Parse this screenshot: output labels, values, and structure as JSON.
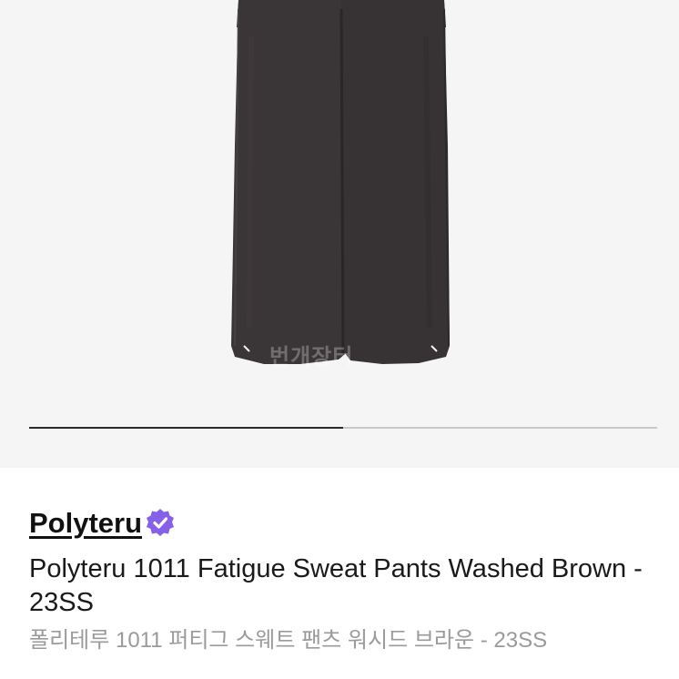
{
  "gallery": {
    "watermark_text": "번개장터",
    "progress": 0.5,
    "colors": {
      "background": "#f5f5f5",
      "pants": "#3a3536",
      "track": "#c8c8c8",
      "fill": "#2a2a2a"
    }
  },
  "product": {
    "brand": "Polyteru",
    "verified_icon": "verified-badge-icon",
    "verified_color": "#8560e8",
    "title": "Polyteru 1011 Fatigue Sweat Pants Washed Brown - 23SS",
    "subtitle": "폴리테루 1011 퍼티그 스웨트 팬츠 워시드 브라운 - 23SS"
  }
}
